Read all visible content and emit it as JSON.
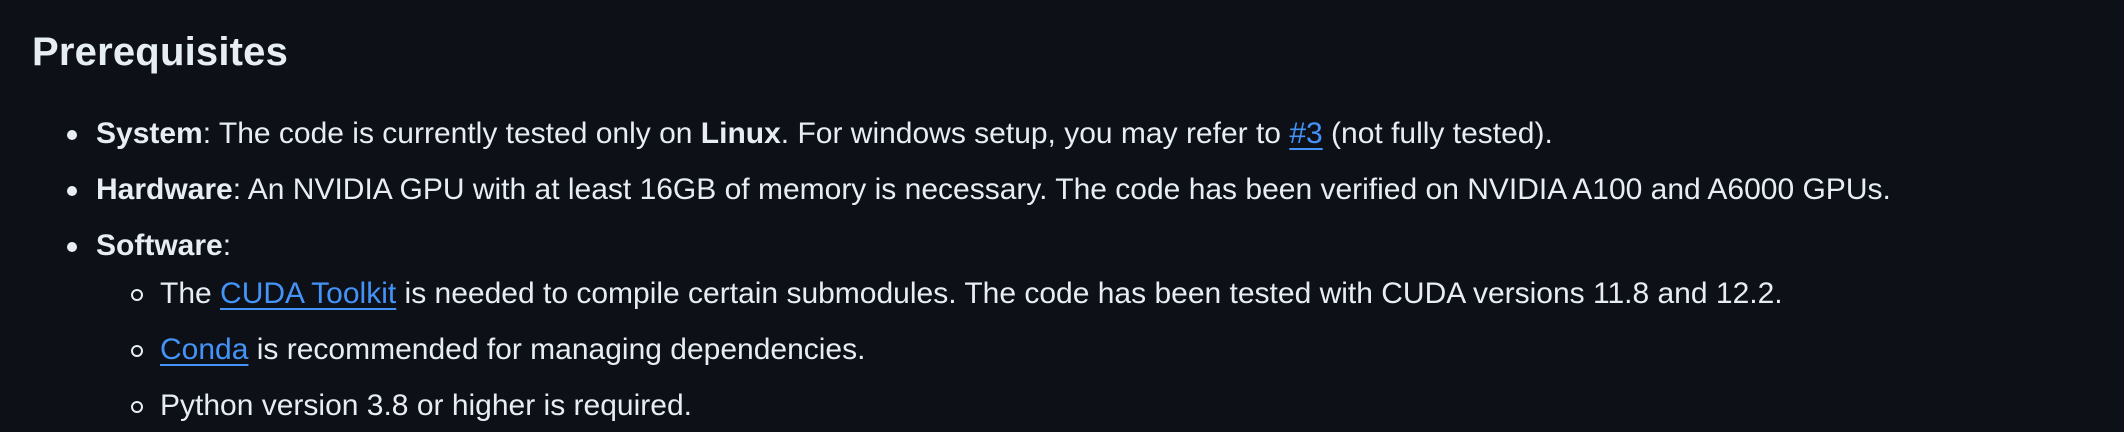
{
  "heading": "Prerequisites",
  "items": {
    "system": {
      "label": "System",
      "text1": ": The code is currently tested only on ",
      "bold": "Linux",
      "text2": ". For windows setup, you may refer to ",
      "link": "#3",
      "text3": " (not fully tested)."
    },
    "hardware": {
      "label": "Hardware",
      "text": ": An NVIDIA GPU with at least 16GB of memory is necessary. The code has been verified on NVIDIA A100 and A6000 GPUs."
    },
    "software": {
      "label": "Software",
      "colon": ":",
      "subitems": {
        "cuda": {
          "text1": "The ",
          "link": "CUDA Toolkit",
          "text2": " is needed to compile certain submodules. The code has been tested with CUDA versions 11.8 and 12.2."
        },
        "conda": {
          "link": "Conda",
          "text": " is recommended for managing dependencies."
        },
        "python": {
          "text": "Python version 3.8 or higher is required."
        }
      }
    }
  },
  "colors": {
    "background": "#0d1117",
    "text": "#e6edf3",
    "link": "#4493f8"
  }
}
